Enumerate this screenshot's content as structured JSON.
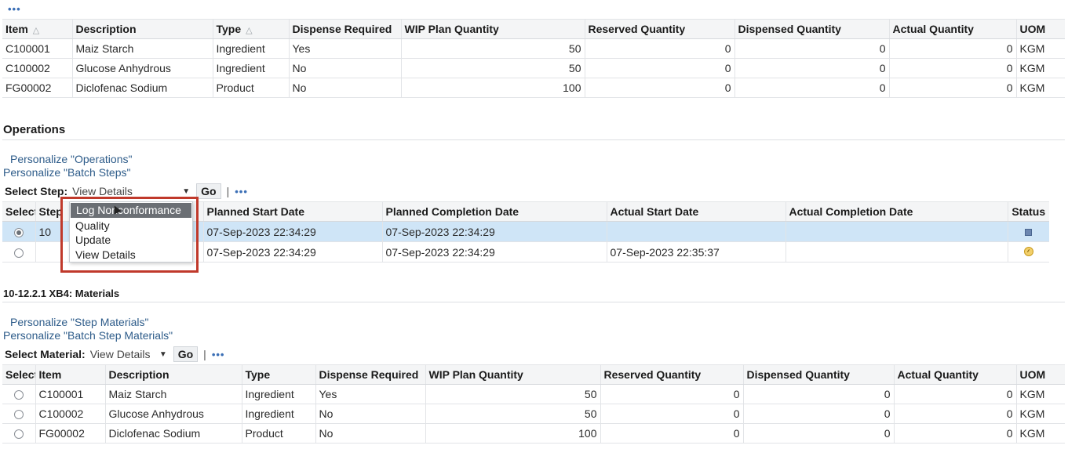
{
  "top_menu_dots": "•••",
  "top_table": {
    "headers": [
      "Item",
      "Description",
      "Type",
      "Dispense Required",
      "WIP Plan Quantity",
      "Reserved Quantity",
      "Dispensed Quantity",
      "Actual Quantity",
      "UOM"
    ],
    "rows": [
      [
        "C100001",
        "Maiz Starch",
        "Ingredient",
        "Yes",
        "50",
        "0",
        "0",
        "0",
        "KGM"
      ],
      [
        "C100002",
        "Glucose Anhydrous",
        "Ingredient",
        "No",
        "50",
        "0",
        "0",
        "0",
        "KGM"
      ],
      [
        "FG00002",
        "Diclofenac Sodium",
        "Product",
        "No",
        "100",
        "0",
        "0",
        "0",
        "KGM"
      ]
    ]
  },
  "operations": {
    "title": "Operations",
    "personalize_ops": "Personalize \"Operations\"",
    "personalize_steps": "Personalize \"Batch Steps\"",
    "select_label": "Select Step:",
    "select_value": "View Details",
    "go": "Go",
    "dots": "•••",
    "headers": [
      "Select",
      "Step",
      "Planned Start Date",
      "Planned Completion Date",
      "Actual Start Date",
      "Actual Completion Date",
      "Status"
    ],
    "rows": [
      {
        "step": "10",
        "planned_start": "07-Sep-2023 22:34:29",
        "planned_completion": "07-Sep-2023 22:34:29",
        "actual_start": "",
        "actual_completion": "",
        "status": "square-status-icon"
      },
      {
        "step": "",
        "planned_start": "07-Sep-2023 22:34:29",
        "planned_completion": "07-Sep-2023 22:34:29",
        "actual_start": "07-Sep-2023 22:35:37",
        "actual_completion": "",
        "status": "clock-status-icon"
      }
    ],
    "menu": [
      "Log Nonconformance",
      "Quality",
      "Update",
      "View Details"
    ]
  },
  "materials": {
    "title": "10-12.2.1 XB4: Materials",
    "personalize_step": "Personalize \"Step Materials\"",
    "personalize_batch": "Personalize \"Batch Step Materials\"",
    "select_label": "Select Material:",
    "select_value": "View Details",
    "go": "Go",
    "dots": "•••",
    "headers": [
      "Select",
      "Item",
      "Description",
      "Type",
      "Dispense Required",
      "WIP Plan Quantity",
      "Reserved Quantity",
      "Dispensed Quantity",
      "Actual Quantity",
      "UOM"
    ],
    "rows": [
      [
        "C100001",
        "Maiz Starch",
        "Ingredient",
        "Yes",
        "50",
        "0",
        "0",
        "0",
        "KGM"
      ],
      [
        "C100002",
        "Glucose Anhydrous",
        "Ingredient",
        "No",
        "50",
        "0",
        "0",
        "0",
        "KGM"
      ],
      [
        "FG00002",
        "Diclofenac Sodium",
        "Product",
        "No",
        "100",
        "0",
        "0",
        "0",
        "KGM"
      ]
    ]
  },
  "colors": {
    "link": "#2e5c8a",
    "selected_row": "#cfe5f7",
    "highlight_box": "#c0392b",
    "menu_highlight": "#6b6f74"
  }
}
